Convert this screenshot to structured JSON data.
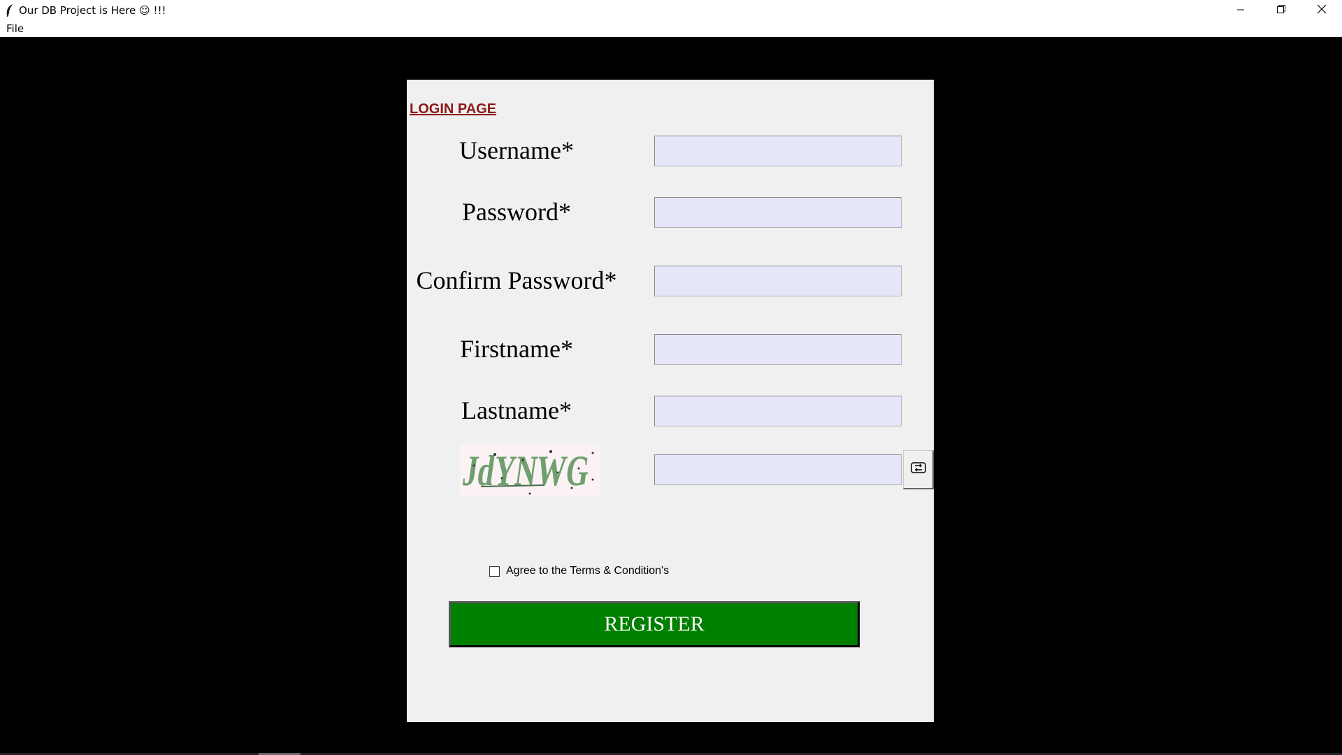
{
  "window": {
    "title": "Our DB Project is Here ☺  !!!"
  },
  "menubar": {
    "items": [
      {
        "label": "File"
      }
    ]
  },
  "form": {
    "heading": "LOGIN PAGE",
    "fields": [
      {
        "label": "Username*",
        "value": ""
      },
      {
        "label": "Password*",
        "value": ""
      },
      {
        "label": "Confirm Password*",
        "value": ""
      },
      {
        "label": "Firstname*",
        "value": ""
      },
      {
        "label": "Lastname*",
        "value": ""
      }
    ],
    "captcha": {
      "text": "JdYNWG",
      "input_value": ""
    },
    "terms_label": "Agree to the Terms & Condition's",
    "terms_checked": false,
    "register_label": "REGISTER"
  },
  "colors": {
    "background": "#000000",
    "panel": "#f0f0f0",
    "input_bg": "#e6e6fa",
    "heading": "#8b1a1a",
    "register_bg": "#008000",
    "register_text": "#ffffff",
    "captcha_text": "#6f9f6f"
  },
  "icons": {
    "app": "feather-icon",
    "minimize": "minimize-icon",
    "maximize": "restore-icon",
    "close": "close-icon",
    "refresh": "refresh-icon"
  }
}
